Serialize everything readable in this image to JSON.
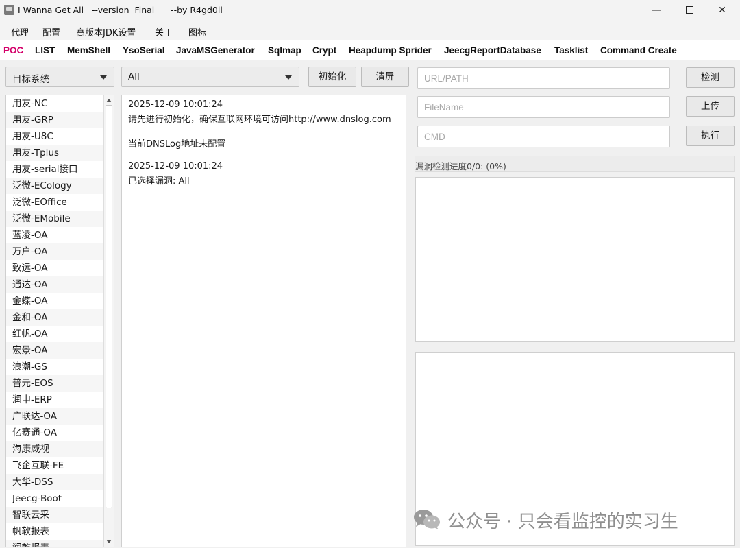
{
  "window": {
    "title": "I Wanna Get All   --version  Final      --by R4gd0ll",
    "minimize": "—",
    "close": "✕"
  },
  "menu": [
    "代理",
    "配置",
    "高版本JDK设置",
    "关于",
    "图标"
  ],
  "tabs": [
    {
      "label": "POC",
      "active": true
    },
    {
      "label": "LIST"
    },
    {
      "label": "MemShell"
    },
    {
      "label": "YsoSerial"
    },
    {
      "label": "JavaMSGenerator"
    },
    {
      "label": "Sqlmap"
    },
    {
      "label": "Crypt"
    },
    {
      "label": "Heapdump Sprider"
    },
    {
      "label": "JeecgReportDatabase"
    },
    {
      "label": "Tasklist"
    },
    {
      "label": "Command Create"
    }
  ],
  "target_combo": {
    "value": "目标系统"
  },
  "vuln_combo": {
    "value": "All"
  },
  "buttons": {
    "init": "初始化",
    "clear": "清屏",
    "detect": "检测",
    "upload": "上传",
    "execute": "执行"
  },
  "targets": [
    "用友-NC",
    "用友-GRP",
    "用友-U8C",
    "用友-Tplus",
    "用友-serial接口",
    "泛微-ECology",
    "泛微-EOffice",
    "泛微-EMobile",
    "蓝凌-OA",
    "万户-OA",
    "致远-OA",
    "通达-OA",
    "金蝶-OA",
    "金和-OA",
    "红帆-OA",
    "宏景-OA",
    "浪潮-GS",
    "普元-EOS",
    "润申-ERP",
    "广联达-OA",
    "亿赛通-OA",
    "海康威视",
    "飞企互联-FE",
    "大华-DSS",
    "Jeecg-Boot",
    "智联云采",
    "帆软报表",
    "润乾报表"
  ],
  "log": [
    "2025-12-09 10:01:24",
    "请先进行初始化，确保互联网环境可访问http://www.dnslog.com",
    "当前DNSLog地址未配置",
    "2025-12-09 10:01:24",
    "已选择漏洞: All"
  ],
  "inputs": {
    "url_placeholder": "URL/PATH",
    "filename_placeholder": "FileName",
    "cmd_placeholder": "CMD"
  },
  "progress": {
    "label": "漏洞检测进度0/0: (0%)",
    "fraction": 0
  },
  "watermark": "公众号 · 只会看监控的实习生",
  "colors": {
    "active_tab": "#d4006a",
    "background": "#f0f0f0"
  }
}
